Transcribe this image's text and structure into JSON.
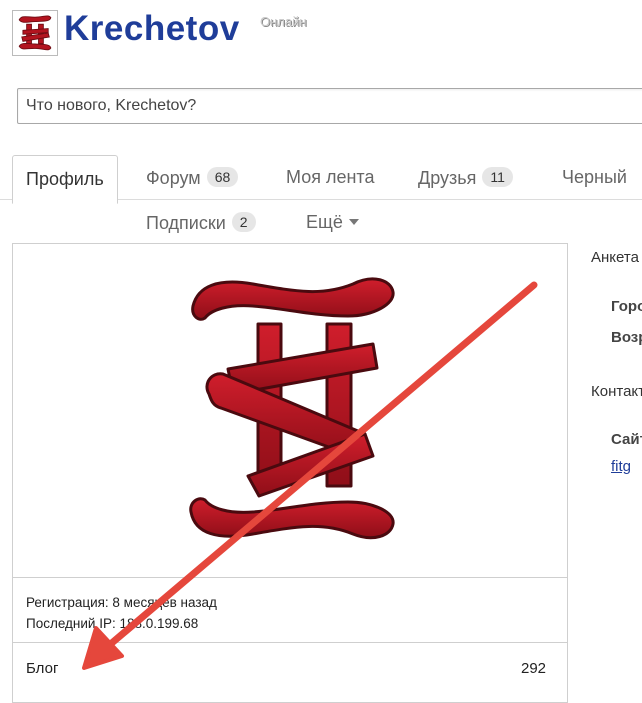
{
  "header": {
    "username": "Krechetov",
    "online_label": "Онлайн",
    "brand_color": "#1f3d99"
  },
  "status": {
    "placeholder": "Что нового, Krechetov?"
  },
  "tabs": [
    {
      "label": "Профиль",
      "active": true
    },
    {
      "label": "Форум",
      "count": "68"
    },
    {
      "label": "Моя лента"
    },
    {
      "label": "Друзья",
      "count": "11"
    },
    {
      "label": "Черный"
    }
  ],
  "tabs_row2": [
    {
      "label": "Подписки",
      "count": "2"
    },
    {
      "label": "Ещё"
    }
  ],
  "profile": {
    "registration": "Регистрация: 8 месяцев назад",
    "last_ip": "Последний IP: 188.0.199.68",
    "blog_label": "Блог",
    "blog_count": "292"
  },
  "right": {
    "section_profile": "Анкета",
    "city": "Город",
    "age": "Возраст",
    "section_contacts": "Контакты",
    "site_label": "Сайт",
    "site_link": "fitg"
  },
  "colors": {
    "logo_red": "#b3141f",
    "arrow_red": "#e5473c"
  }
}
